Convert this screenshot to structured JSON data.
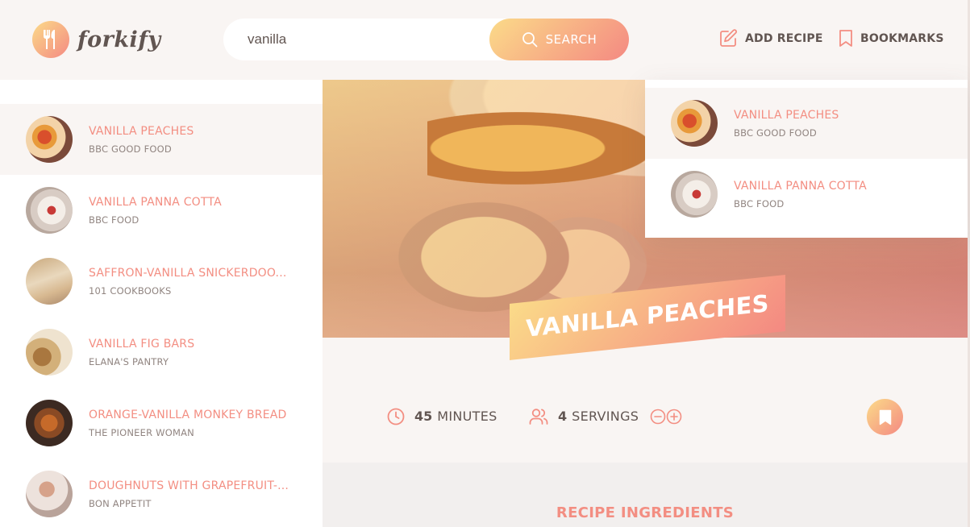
{
  "header": {
    "logo_text": "forkify",
    "search_value": "vanilla",
    "search_button": "SEARCH",
    "add_recipe": "ADD RECIPE",
    "bookmarks": "BOOKMARKS"
  },
  "results": [
    {
      "title": "VANILLA PEACHES",
      "publisher": "BBC GOOD FOOD",
      "thumb": "t-peach",
      "active": true
    },
    {
      "title": "VANILLA PANNA COTTA",
      "publisher": "BBC FOOD",
      "thumb": "t-panna",
      "active": false
    },
    {
      "title": "SAFFRON-VANILLA SNICKERDOO...",
      "publisher": "101 COOKBOOKS",
      "thumb": "t-saffron",
      "active": false
    },
    {
      "title": "VANILLA FIG BARS",
      "publisher": "ELANA'S PANTRY",
      "thumb": "t-fig",
      "active": false
    },
    {
      "title": "ORANGE-VANILLA MONKEY BREAD",
      "publisher": "THE PIONEER WOMAN",
      "thumb": "t-monkey",
      "active": false
    },
    {
      "title": "DOUGHNUTS WITH GRAPEFRUIT-...",
      "publisher": "BON APPETIT",
      "thumb": "t-dough",
      "active": false
    }
  ],
  "bookmark_list": [
    {
      "title": "VANILLA PEACHES",
      "publisher": "BBC GOOD FOOD",
      "thumb": "t-peach",
      "active": true
    },
    {
      "title": "VANILLA PANNA COTTA",
      "publisher": "BBC FOOD",
      "thumb": "t-panna",
      "active": false
    }
  ],
  "recipe": {
    "title": "VANILLA PEACHES",
    "minutes": "45",
    "minutes_label": "MINUTES",
    "servings": "4",
    "servings_label": "SERVINGS",
    "ingredients_heading": "RECIPE INGREDIENTS"
  },
  "icons": {
    "logo": "fork-knife-icon",
    "search": "search-icon",
    "add_recipe": "edit-icon",
    "bookmarks": "bookmark-icon",
    "time": "clock-icon",
    "servings": "users-icon",
    "decrease": "minus-circle-icon",
    "increase": "plus-circle-icon",
    "bookmark_button": "bookmark-fill-icon"
  },
  "colors": {
    "accent": "#f38e82",
    "gradient_start": "#fbdb89",
    "gradient_end": "#f48982",
    "text": "#615551"
  }
}
